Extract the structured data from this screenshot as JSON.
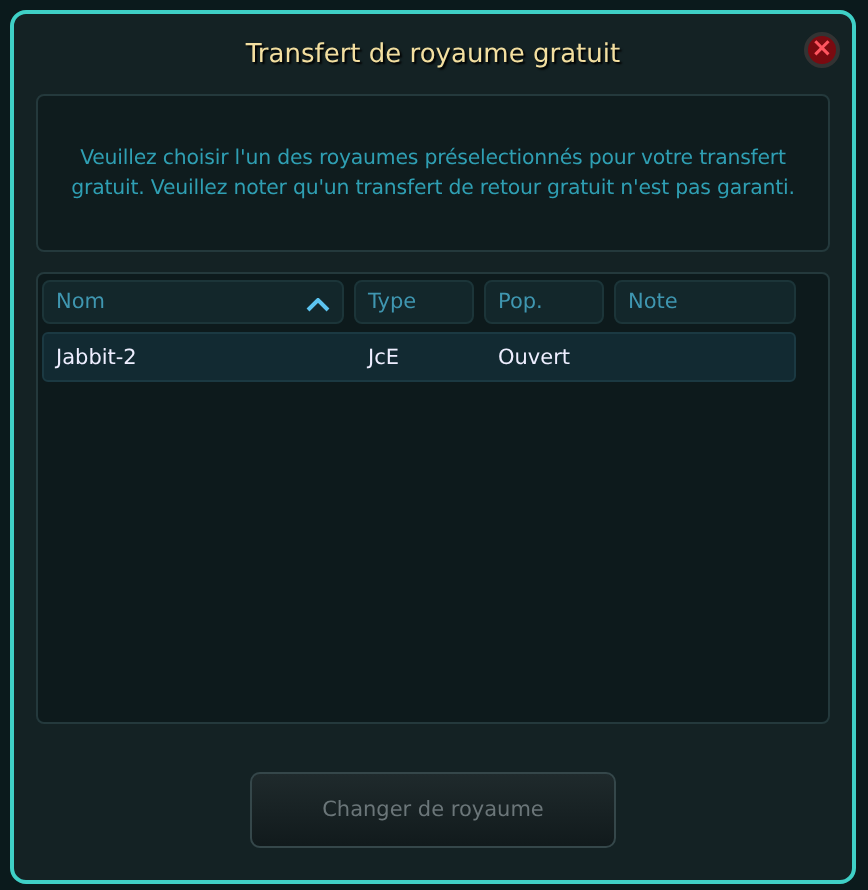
{
  "dialog": {
    "title": "Transfert de royaume gratuit",
    "close": "×"
  },
  "message": "Veuillez choisir l'un des royaumes préselectionnés pour votre transfert gratuit. Veuillez noter qu'un transfert de retour gratuit n'est pas garanti.",
  "table": {
    "columns": [
      {
        "label": "Nom",
        "sorted": true
      },
      {
        "label": "Type",
        "sorted": false
      },
      {
        "label": "Pop.",
        "sorted": false
      },
      {
        "label": "Note",
        "sorted": false
      }
    ],
    "rows": [
      {
        "cells": [
          "Jabbit-2",
          "JcE",
          "Ouvert"
        ],
        "selected": true
      }
    ]
  },
  "button": {
    "label": "Changer de royaume",
    "disabled": true
  }
}
